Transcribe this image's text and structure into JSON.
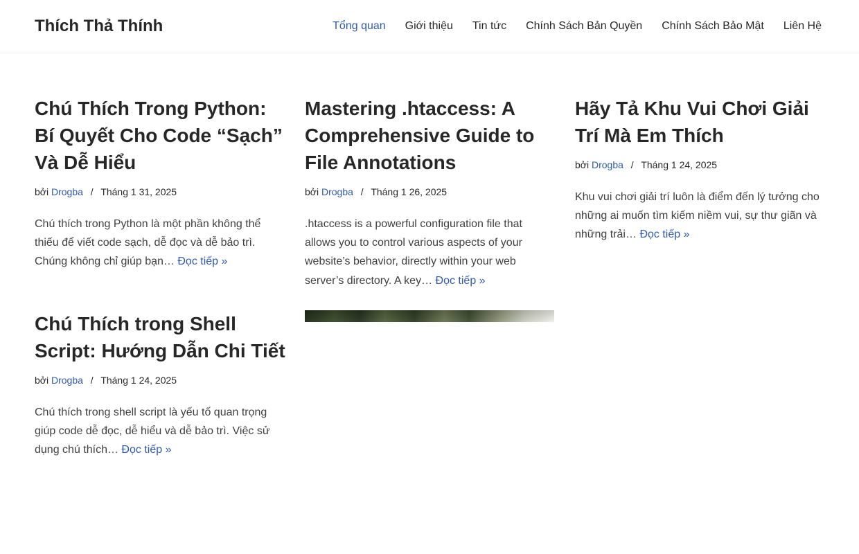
{
  "site": {
    "title": "Thích Thả Thính"
  },
  "nav": [
    {
      "label": "Tổng quan",
      "active": true
    },
    {
      "label": "Giới thiệu"
    },
    {
      "label": "Tin tức"
    },
    {
      "label": "Chính Sách Bản Quyền"
    },
    {
      "label": "Chính Sách Bảo Mật"
    },
    {
      "label": "Liên Hệ"
    }
  ],
  "posts": [
    {
      "title": "Chú Thích Trong Python: Bí Quyết Cho Code “Sạch” Và Dễ Hiểu",
      "by": "bởi",
      "author": "Drogba",
      "sep": "/",
      "date": "Tháng 1 31, 2025",
      "excerpt": "Chú thích trong Python là một phần không thể thiếu để viết code sạch, dễ đọc và dễ bảo trì. Chúng không chỉ giúp bạn…",
      "read_more": "Đọc tiếp »"
    },
    {
      "title": "Mastering .htaccess: A Comprehensive Guide to File Annotations",
      "by": "bởi",
      "author": "Drogba",
      "sep": "/",
      "date": "Tháng 1 26, 2025",
      "excerpt": ".htaccess is a powerful configuration file that allows you to control various aspects of your website’s behavior, directly within your web server’s directory. A key…",
      "read_more": "Đọc tiếp »"
    },
    {
      "title": "Hãy Tả Khu Vui Chơi Giải Trí Mà Em Thích",
      "by": "bởi",
      "author": "Drogba",
      "sep": "/",
      "date": "Tháng 1 24, 2025",
      "excerpt": "Khu vui chơi giải trí luôn là điểm đến lý tưởng cho những ai muốn tìm kiếm niềm vui, sự thư giãn và những trải…",
      "read_more": "Đọc tiếp »"
    },
    {
      "title": "Chú Thích trong Shell Script: Hướng Dẫn Chi Tiết",
      "by": "bởi",
      "author": "Drogba",
      "sep": "/",
      "date": "Tháng 1 24, 2025",
      "excerpt": "Chú thích trong shell script là yếu tố quan trọng giúp code dễ đọc, dễ hiểu và dễ bảo trì. Việc sử dụng chú thích…",
      "read_more": "Đọc tiếp »"
    }
  ],
  "colors": {
    "link": "#2f5aae",
    "text": "#272727"
  }
}
